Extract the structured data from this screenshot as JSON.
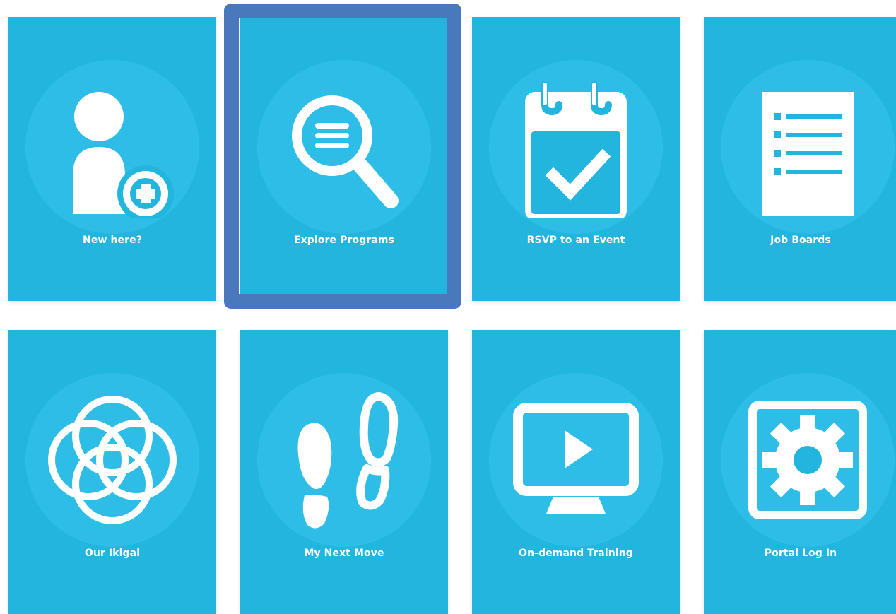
{
  "tiles": [
    {
      "label": "New here?",
      "icon": "user-plus-icon"
    },
    {
      "label": "Explore Programs",
      "icon": "search-list-icon",
      "selected": true
    },
    {
      "label": "RSVP to an Event",
      "icon": "calendar-check-icon"
    },
    {
      "label": "Job Boards",
      "icon": "document-list-icon"
    },
    {
      "label": "Our Ikigai",
      "icon": "ikigai-circles-icon"
    },
    {
      "label": "My Next Move",
      "icon": "footprints-icon"
    },
    {
      "label": "On-demand Training",
      "icon": "monitor-play-icon"
    },
    {
      "label": "Portal Log In",
      "icon": "gear-box-icon"
    }
  ],
  "colors": {
    "tile": "#22b5de",
    "halo": "#2ebde6",
    "selection": "#4a78bd",
    "text": "#ffffff"
  }
}
